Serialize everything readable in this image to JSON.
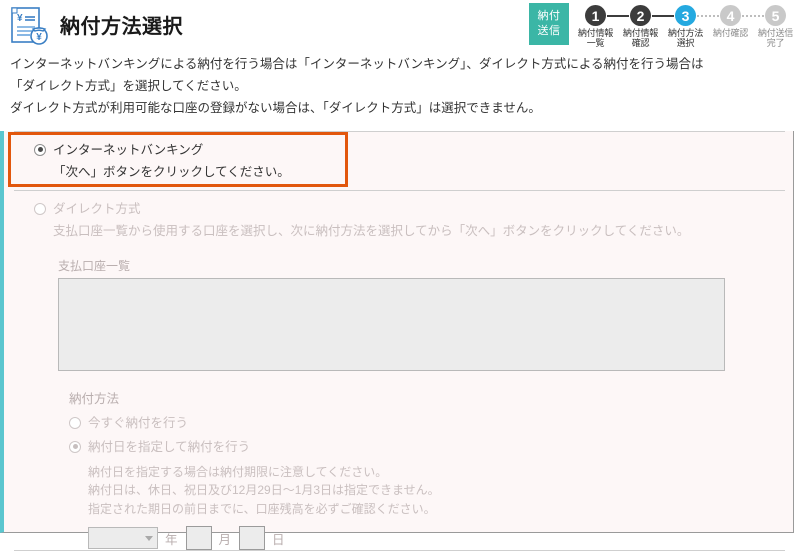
{
  "header": {
    "title": "納付方法選択",
    "icon": "payment-document-icon"
  },
  "stepper": {
    "badge_line1": "納付",
    "badge_line2": "送信",
    "steps": [
      {
        "number": "1",
        "label": "納付情報\n一覧",
        "state": "done"
      },
      {
        "number": "2",
        "label": "納付情報\n確認",
        "state": "done"
      },
      {
        "number": "3",
        "label": "納付方法\n選択",
        "state": "current"
      },
      {
        "number": "4",
        "label": "納付確認",
        "state": "upcoming"
      },
      {
        "number": "5",
        "label": "納付送信\n完了",
        "state": "upcoming"
      }
    ]
  },
  "intro": {
    "line1": "インターネットバンキングによる納付を行う場合は「インターネットバンキング」、ダイレクト方式による納付を行う場合は",
    "line2": "「ダイレクト方式」を選択してください。",
    "line3": "ダイレクト方式が利用可能な口座の登録がない場合は、「ダイレクト方式」は選択できません。"
  },
  "options": {
    "internet_banking": {
      "label": "インターネットバンキング",
      "description": "「次へ」ボタンをクリックしてください。",
      "checked": true
    },
    "direct": {
      "label": "ダイレクト方式",
      "description": "支払口座一覧から使用する口座を選択し、次に納付方法を選択してから「次へ」ボタンをクリックしてください。",
      "checked": false
    }
  },
  "account_list": {
    "caption": "支払口座一覧",
    "items": []
  },
  "payment_method": {
    "caption": "納付方法",
    "option_now": "今すぐ納付を行う",
    "option_scheduled": "納付日を指定して納付を行う",
    "note1": "納付日を指定する場合は納付期限に注意してください。",
    "note2": "納付日は、休日、祝日及び12月29日～1月3日は指定できません。",
    "note3": "指定された期日の前日までに、口座残高を必ずご確認ください。"
  },
  "date_inputs": {
    "year_value": "",
    "year_unit": "年",
    "month_value": "",
    "month_unit": "月",
    "day_value": "",
    "day_unit": "日"
  },
  "colors": {
    "accent_teal": "#3bb6a6",
    "current_step": "#25a9e0",
    "highlight_orange": "#e2570d",
    "panel_bg": "#fdf7f7",
    "left_rule": "#5bc6cf"
  }
}
